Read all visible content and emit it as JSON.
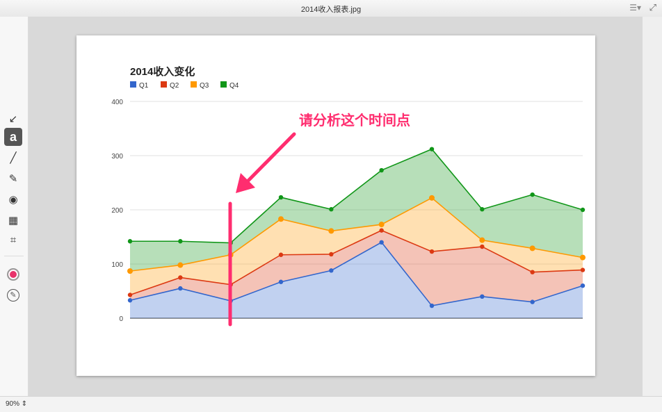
{
  "window": {
    "title": "2014收入报表.jpg",
    "menu_icon": "list-menu-icon",
    "fullscreen_icon": "fullscreen-icon"
  },
  "toolbar": {
    "tools": [
      {
        "name": "arrow-tool",
        "icon": "arrow-icon",
        "glyph": "↙",
        "active": false
      },
      {
        "name": "text-tool",
        "icon": "text-icon",
        "glyph": "a",
        "active": true
      },
      {
        "name": "line-tool",
        "icon": "line-icon",
        "glyph": "╱",
        "active": false
      },
      {
        "name": "pen-tool",
        "icon": "pen-icon",
        "glyph": "✎",
        "active": false
      },
      {
        "name": "highlight-tool",
        "icon": "eye-icon",
        "glyph": "◉",
        "active": false
      },
      {
        "name": "pixelate-tool",
        "icon": "pixelate-icon",
        "glyph": "▦",
        "active": false
      },
      {
        "name": "crop-tool",
        "icon": "crop-icon",
        "glyph": "⌗",
        "active": false
      }
    ],
    "color": "#e8336b",
    "edit_icon": "pencil-circle-icon"
  },
  "status": {
    "zoom": "90%"
  },
  "annotation": {
    "text": "请分析这个时间点",
    "color": "#ff2d6f"
  },
  "chart_data": {
    "type": "area",
    "stacked": true,
    "title": "2014收入变化",
    "xlabel": "",
    "ylabel": "",
    "ylim": [
      0,
      400
    ],
    "yticks": [
      0,
      100,
      200,
      300,
      400
    ],
    "grid": true,
    "legend": "top-left",
    "series": [
      {
        "name": "Q1",
        "color": "#3366cc",
        "values": [
          33,
          55,
          32,
          67,
          88,
          140,
          23,
          40,
          30,
          60
        ]
      },
      {
        "name": "Q2",
        "color": "#dc3912",
        "values": [
          10,
          20,
          30,
          50,
          30,
          22,
          100,
          92,
          55,
          29
        ]
      },
      {
        "name": "Q3",
        "color": "#ff9900",
        "values": [
          44,
          23,
          55,
          66,
          43,
          11,
          99,
          12,
          44,
          23
        ]
      },
      {
        "name": "Q4",
        "color": "#109618",
        "values": [
          55,
          44,
          22,
          40,
          40,
          100,
          90,
          57,
          99,
          88
        ]
      }
    ]
  }
}
